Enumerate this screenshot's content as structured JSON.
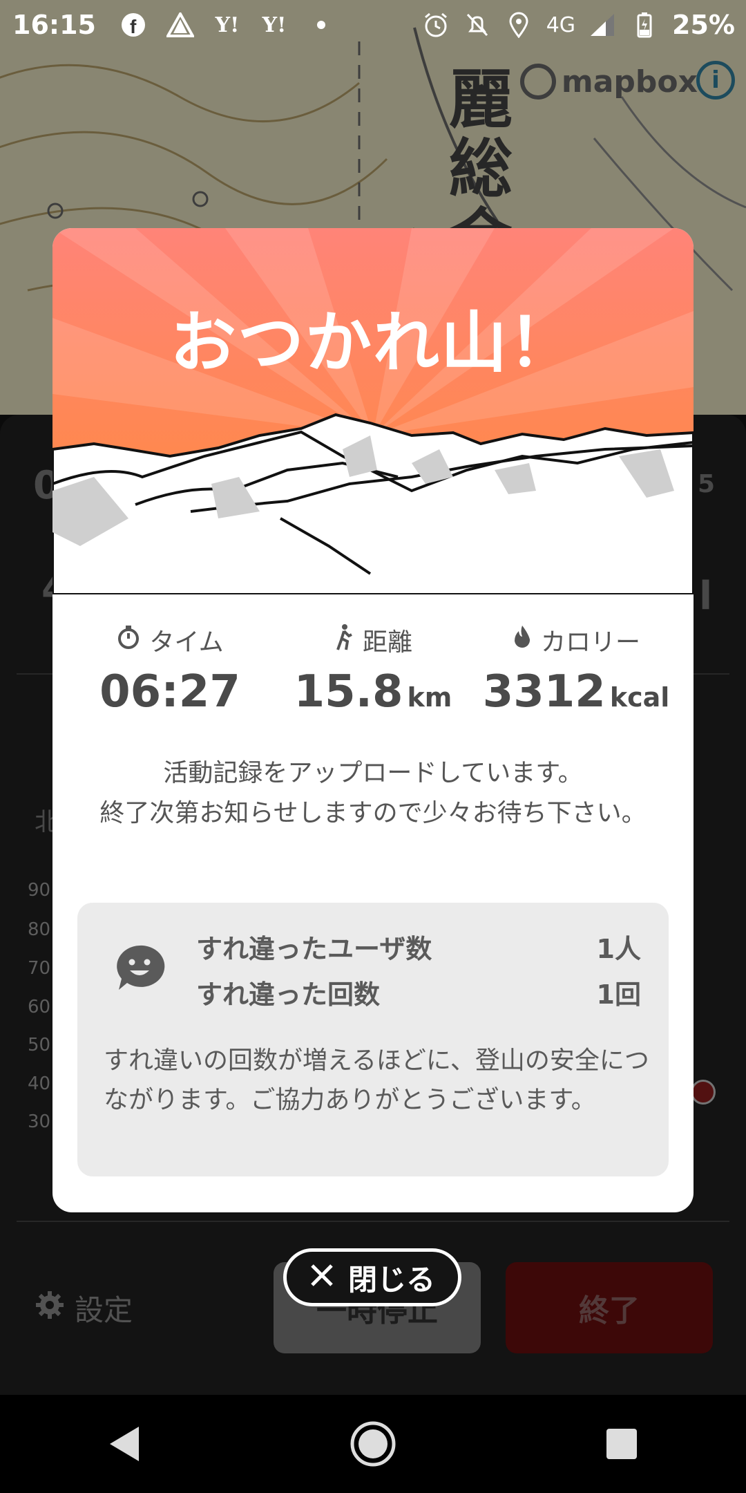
{
  "status_bar": {
    "time": "16:15",
    "network": "4G",
    "battery": "25%"
  },
  "map": {
    "label_chars": [
      "麗",
      "総",
      "会"
    ],
    "attribution": "mapbox",
    "info_symbol": "i"
  },
  "sheet": {
    "ghost_left_top": "0",
    "ghost_left_mid": "4",
    "ghost_right_top": "5",
    "ghost_right_mid": "l",
    "north_char": "北",
    "y_ticks": [
      "90",
      "80",
      "70",
      "60",
      "50",
      "40",
      "30"
    ],
    "settings_label": "設定",
    "pause_label": "一時停止",
    "end_label": "終了"
  },
  "modal": {
    "title": "おつかれ山！",
    "stats": {
      "time_label": "タイム",
      "time_value": "06:27",
      "distance_label": "距離",
      "distance_value": "15.8",
      "distance_unit": "km",
      "calorie_label": "カロリー",
      "calorie_value": "3312",
      "calorie_unit": "kcal"
    },
    "upload_message_line1": "活動記録をアップロードしています。",
    "upload_message_line2": "終了次第お知らせしますので少々お待ち下さい。",
    "passings": {
      "users_label": "すれ違ったユーザ数",
      "users_value": "1人",
      "count_label": "すれ違った回数",
      "count_value": "1回",
      "note": "すれ違いの回数が増えるほどに、登山の安全につながります。ご協力ありがとうございます。"
    }
  },
  "close_button": {
    "label": "閉じる"
  },
  "colors": {
    "hero_top": "#ff8a6e",
    "hero_bottom": "#ff8a3a",
    "end_button": "#5b0d0d"
  }
}
